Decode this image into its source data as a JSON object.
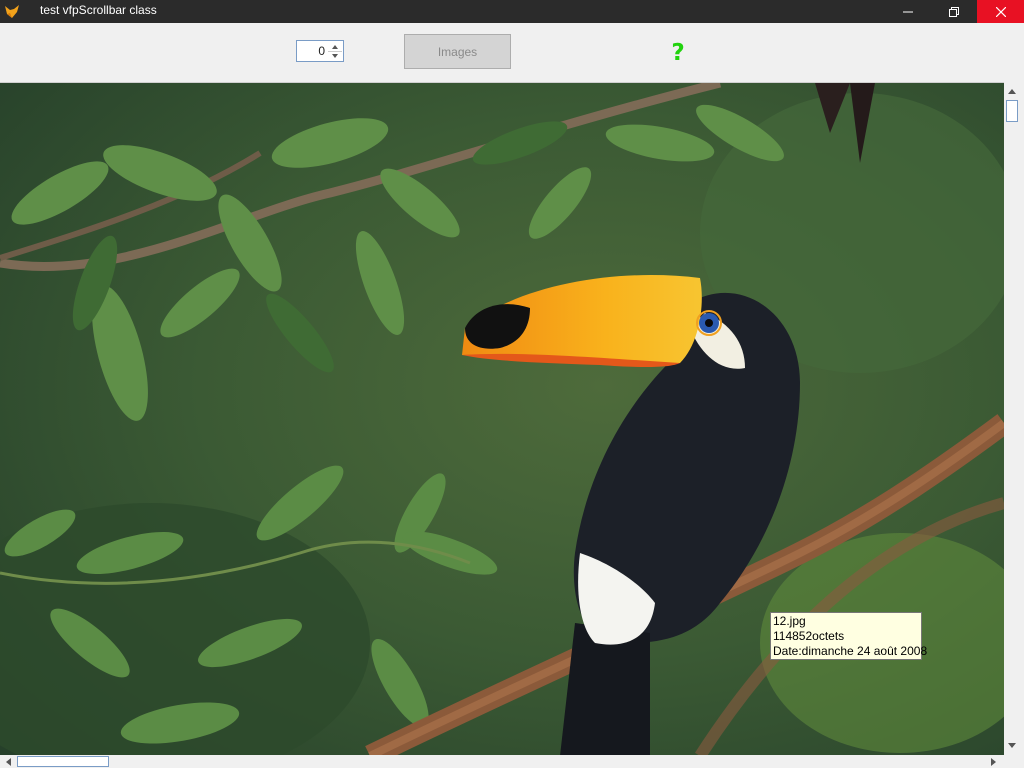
{
  "window": {
    "title": "test vfpScrollbar class",
    "icon": "fox-app-icon",
    "controls": [
      "minimize-icon",
      "restore-icon",
      "close-icon"
    ]
  },
  "toolbar": {
    "spinner_value": "0",
    "images_button_label": "Images",
    "help_label": "?"
  },
  "image_info": {
    "filename": "12.jpg",
    "size": "114852octets",
    "date": "Date:dimanche 24 août 2008"
  },
  "colors": {
    "titlebar": "#2b2b2b",
    "close_button": "#e81123",
    "help_icon": "#22d30e",
    "tooltip_bg": "#ffffe1"
  }
}
